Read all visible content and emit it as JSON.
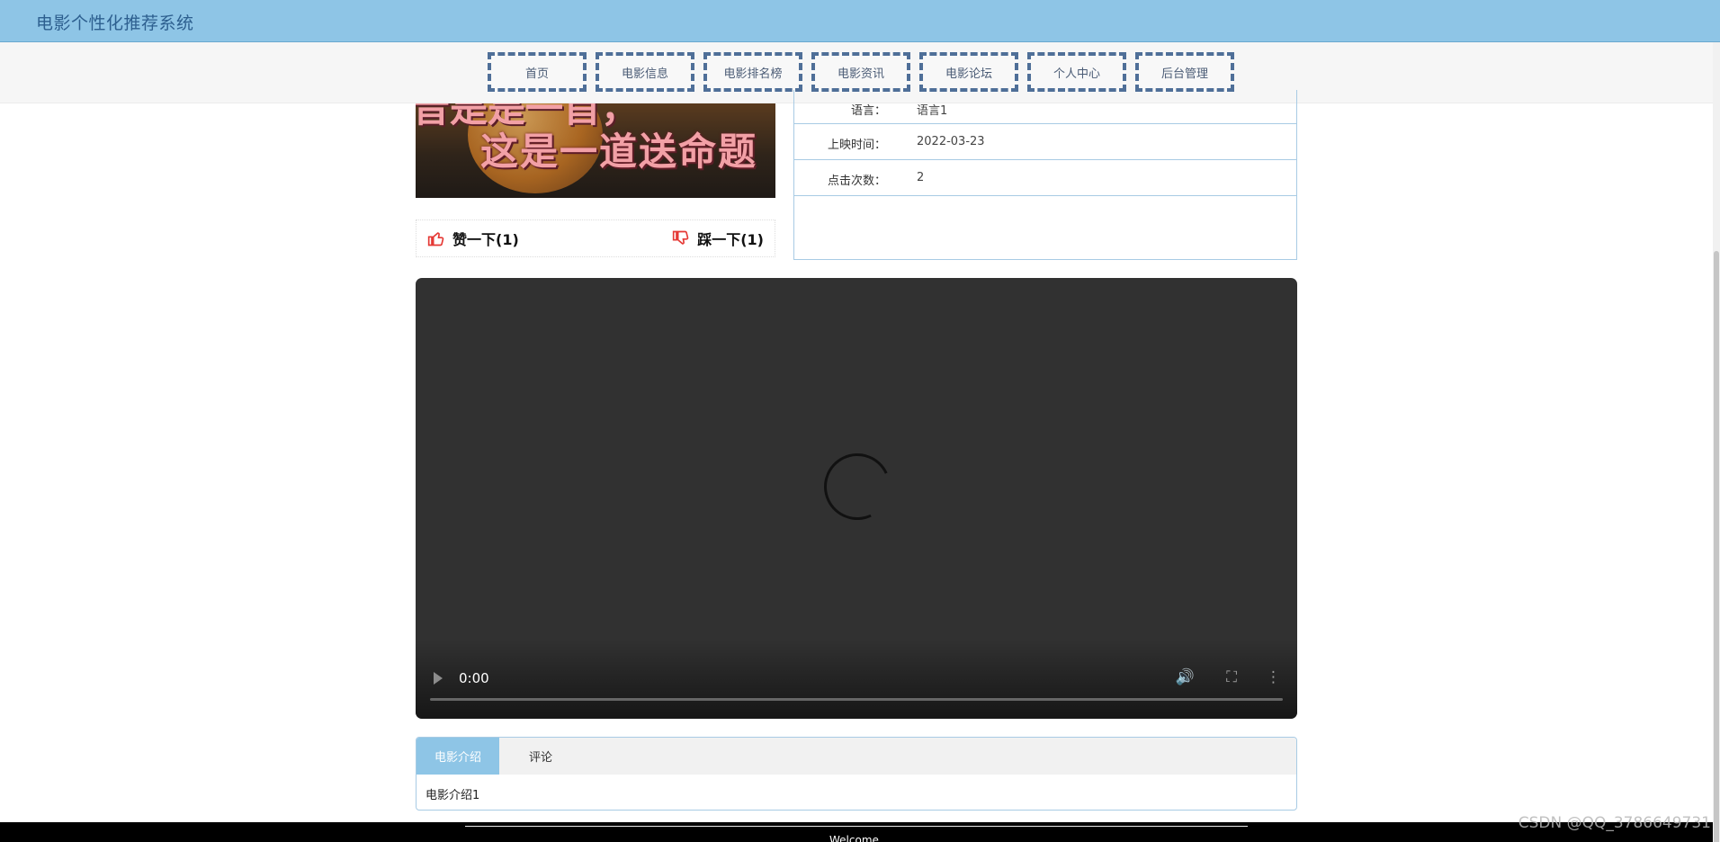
{
  "header": {
    "title": "电影个性化推荐系统"
  },
  "nav": {
    "items": [
      {
        "label": "首页"
      },
      {
        "label": "电影信息"
      },
      {
        "label": "电影排名榜"
      },
      {
        "label": "电影资讯"
      },
      {
        "label": "电影论坛"
      },
      {
        "label": "个人中心"
      },
      {
        "label": "后台管理"
      }
    ]
  },
  "poster": {
    "caption_top": "音是是一首，",
    "caption_main": "这是一道送命题"
  },
  "votes": {
    "like": "赞一下(1)",
    "dislike": "踩一下(1)"
  },
  "info": {
    "rows": [
      {
        "label": "语言：",
        "value": "语言1"
      },
      {
        "label": "上映时间：",
        "value": "2022-03-23"
      },
      {
        "label": "点击次数：",
        "value": "2"
      }
    ]
  },
  "video": {
    "time": "0:00",
    "progress": 0
  },
  "tabs": {
    "items": [
      {
        "label": "电影介绍"
      },
      {
        "label": "评论"
      }
    ],
    "content": "电影介绍1"
  },
  "footer": {
    "text": "Welcome"
  },
  "watermark": "CSDN @QQ_3786649731",
  "colors": {
    "header_bg": "#8ec5e6",
    "nav_border": "#4f6f98",
    "active_tab": "#8ec5e6"
  }
}
